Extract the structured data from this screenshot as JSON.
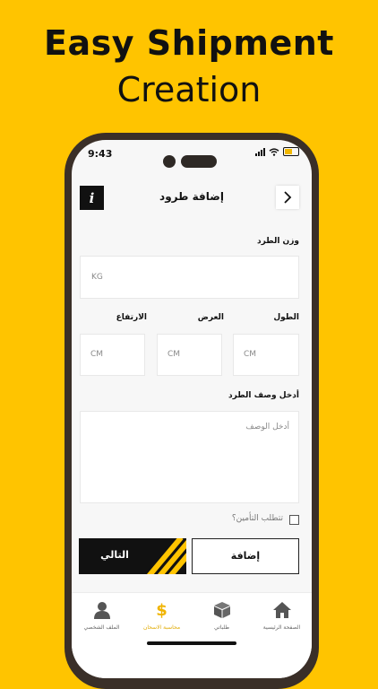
{
  "promo": {
    "line1": "Easy Shipment",
    "line2": "Creation"
  },
  "status_bar": {
    "time": "9:43"
  },
  "header": {
    "title": "إضافة طرود",
    "info_icon": "info-icon",
    "back_icon": "chevron-right-icon"
  },
  "form": {
    "weight_label": "وزن الطرد",
    "weight_placeholder": "KG",
    "length_label": "الطول",
    "width_label": "العرض",
    "height_label": "الارتفاع",
    "dimension_placeholder": "CM",
    "description_label": "أدخل وصف الطرد",
    "description_placeholder": "أدخل الوصف",
    "insurance_label": "تتطلب التأمين؟",
    "insurance_checked": false
  },
  "buttons": {
    "next": "التالي",
    "add": "إضافة"
  },
  "tabs": [
    {
      "label": "الملف الشخصي",
      "icon": "user-icon",
      "active": false
    },
    {
      "label": "محاسبة الاسحان",
      "icon": "dollar-icon",
      "active": true
    },
    {
      "label": "طلباتي",
      "icon": "box-icon",
      "active": false
    },
    {
      "label": "الصفحة الرئيسية",
      "icon": "home-icon",
      "active": false
    }
  ],
  "colors": {
    "brand": "#ffc400",
    "dark": "#111111",
    "phone_frame": "#3a2f28"
  }
}
